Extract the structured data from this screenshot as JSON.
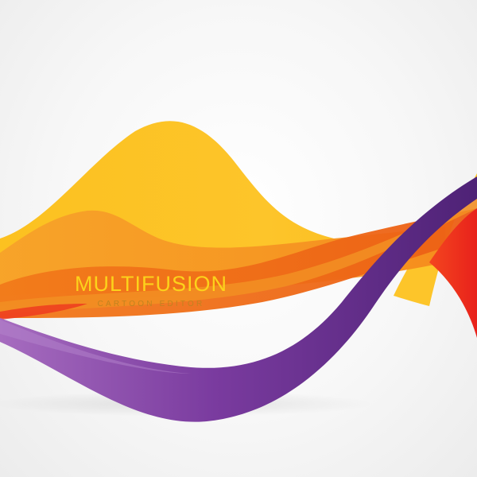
{
  "logo": {
    "title": "MULTIFUSION",
    "tagline": "CARTOON EDITOR"
  },
  "colors": {
    "title": "#fcd21b",
    "tagline": "#c0831f",
    "yellow": "#fdc52a",
    "orange": "#f6921e",
    "deep_orange": "#ef6a1a",
    "red": "#ee2b1f",
    "purple": "#5e2b86",
    "light_purple": "#9a5db5"
  }
}
